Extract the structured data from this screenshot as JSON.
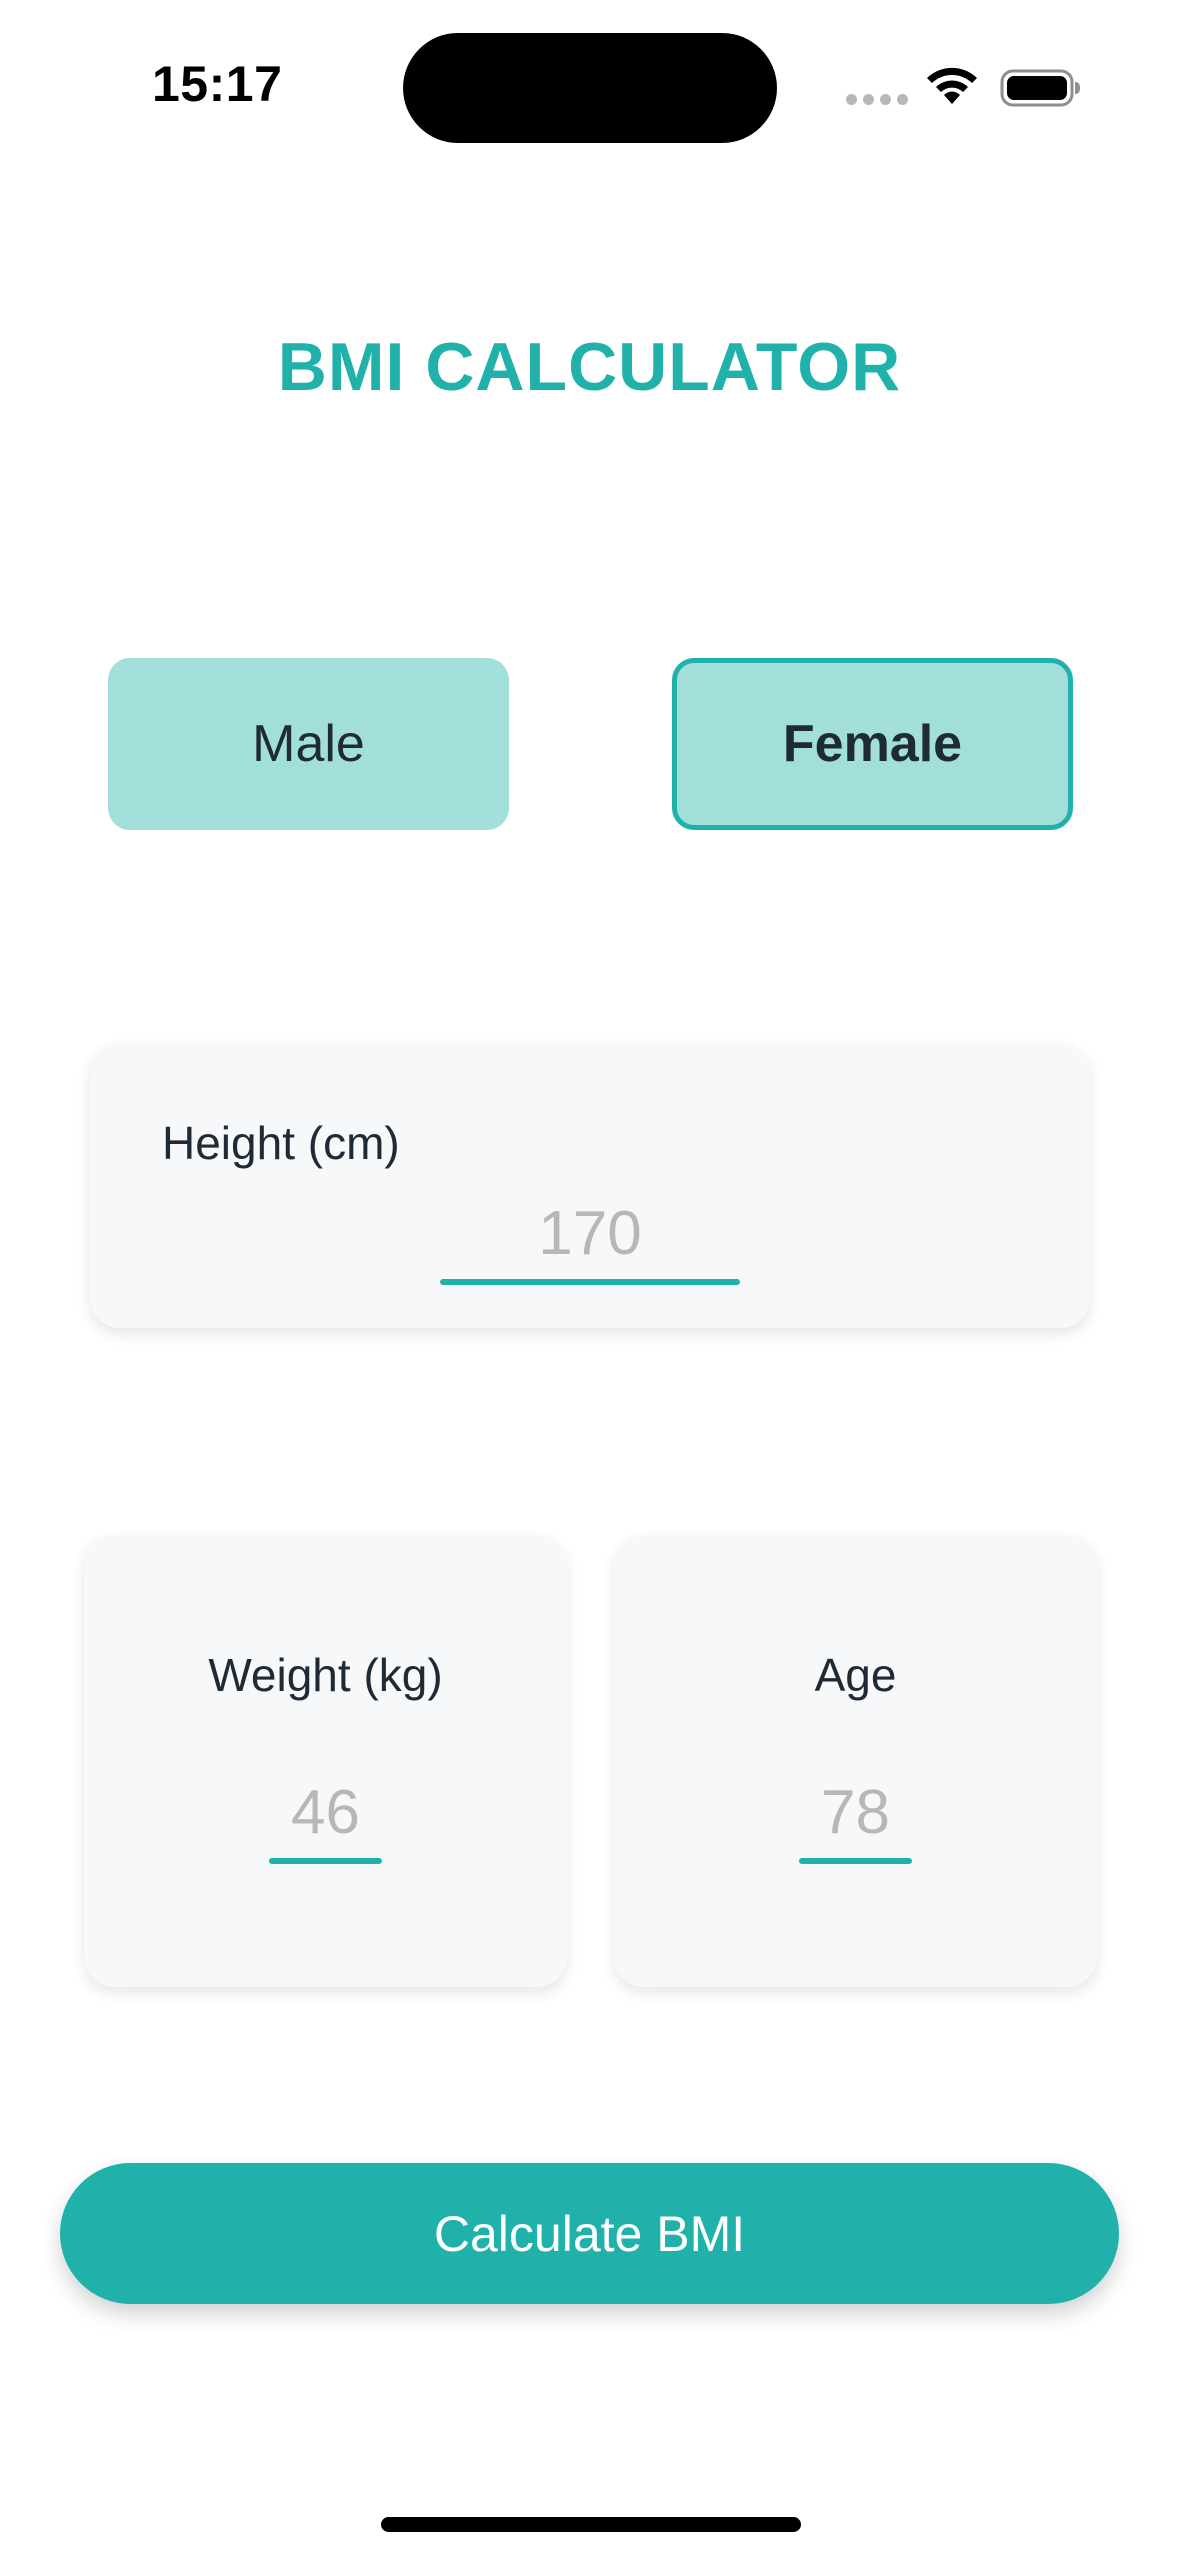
{
  "status_bar": {
    "time": "15:17"
  },
  "header": {
    "title": "BMI CALCULATOR"
  },
  "gender": {
    "options": [
      {
        "label": "Male",
        "selected": false
      },
      {
        "label": "Female",
        "selected": true
      }
    ]
  },
  "height": {
    "label": "Height (cm)",
    "placeholder": "170"
  },
  "weight": {
    "label": "Weight (kg)",
    "placeholder": "46"
  },
  "age": {
    "label": "Age",
    "placeholder": "78"
  },
  "action": {
    "label": "Calculate BMI"
  },
  "colors": {
    "accent": "#20b2aa",
    "gender_bg": "#a2dfdb",
    "card_bg": "#f7f8fa",
    "text_dark": "#1e2a36",
    "placeholder": "#b7b7b7"
  },
  "icons": {
    "signal": "cellular-signal-icon",
    "wifi": "wifi-icon",
    "battery": "battery-icon"
  }
}
